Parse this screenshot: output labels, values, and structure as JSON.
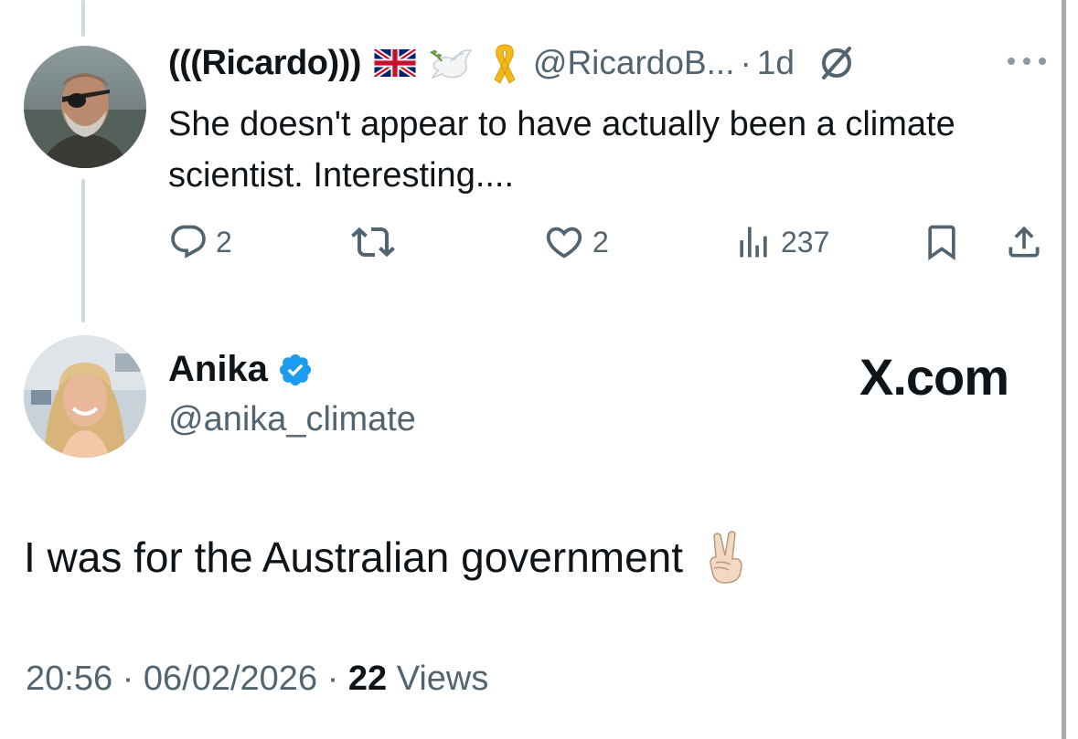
{
  "reply": {
    "author_name": "(((Ricardo)))",
    "handle": "@RicardoB...",
    "separator": "·",
    "time": "1d",
    "text": "She doesn't appear to have actually been a climate scientist. Interesting....",
    "emojis": [
      "uk-flag",
      "dove-with-olive-branch",
      "yellow-ribbon"
    ],
    "actions": {
      "replies": "2",
      "likes": "2",
      "views": "237"
    }
  },
  "tweet": {
    "author_name": "Anika",
    "handle": "@anika_climate",
    "verified": true,
    "watermark": "X.com",
    "text": "I was for the Australian government",
    "emoji": "victory-hand",
    "time": "20:56",
    "date": "06/02/2026",
    "views_count": "22",
    "views_label": "Views",
    "separator": "·"
  },
  "colors": {
    "text": "#0f1419",
    "secondary": "#536471",
    "verified": "#1d9bf0",
    "thread_line": "#cfd9de"
  }
}
